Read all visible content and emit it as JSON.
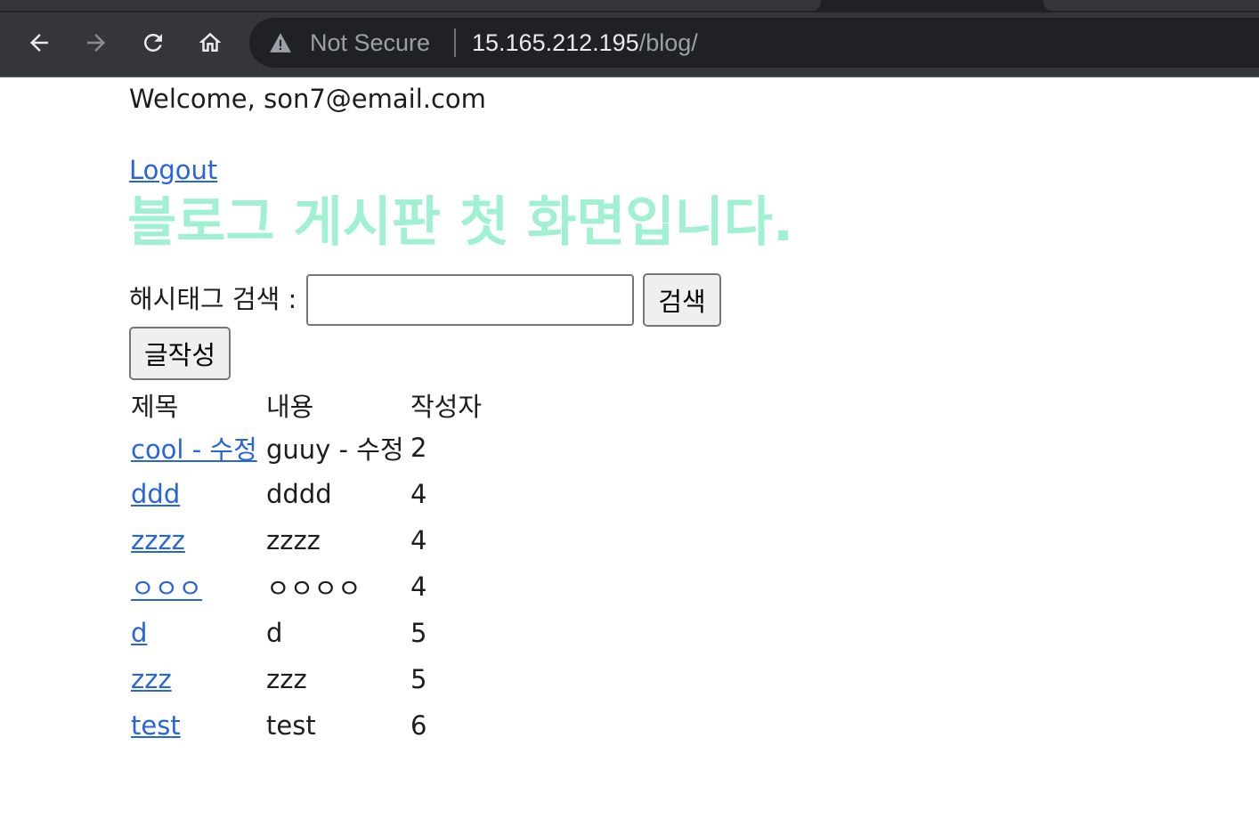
{
  "browser": {
    "security_label": "Not Secure",
    "url_host": "15.165.212.195",
    "url_path": "/blog/",
    "icons": [
      "back-arrow-icon",
      "forward-arrow-icon",
      "reload-icon",
      "home-icon",
      "warning-icon"
    ]
  },
  "page": {
    "welcome": "Welcome, son7@email.com",
    "logout_label": "Logout",
    "title": "블로그 게시판 첫 화면입니다.",
    "title_color": "#a0f0d2",
    "link_color": "#2864e0",
    "search": {
      "label": "해시태그 검색 :",
      "value": "",
      "button_label": "검색"
    },
    "write_button_label": "글작성",
    "table": {
      "headers": [
        "제목",
        "내용",
        "작성자"
      ],
      "rows": [
        {
          "title": "cool - 수정",
          "content": "guuy - 수정",
          "author": "2"
        },
        {
          "title": "ddd",
          "content": "dddd",
          "author": "4"
        },
        {
          "title": "zzzz",
          "content": "zzzz",
          "author": "4"
        },
        {
          "title": "ㅇㅇㅇ",
          "content": "ㅇㅇㅇㅇ",
          "author": "4"
        },
        {
          "title": "d",
          "content": "d",
          "author": "5"
        },
        {
          "title": "zzz",
          "content": "zzz",
          "author": "5"
        },
        {
          "title": "test",
          "content": "test",
          "author": "6"
        }
      ]
    }
  }
}
